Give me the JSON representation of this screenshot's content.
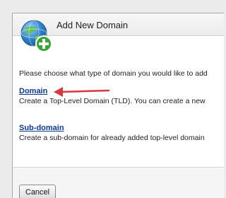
{
  "dialog": {
    "title": "Add New Domain",
    "icon": "globe-add-icon"
  },
  "content": {
    "intro": "Please choose what type of domain you would like to add",
    "options": [
      {
        "label": "Domain",
        "description": "Create a Top-Level Domain (TLD). You can create a new"
      },
      {
        "label": "Sub-domain",
        "description": "Create a sub-domain for already added top-level domain"
      }
    ]
  },
  "footer": {
    "cancel_label": "Cancel"
  },
  "colors": {
    "link": "#0b3a8a",
    "arrow": "#d9363e",
    "globe": "#2f83c9",
    "plus_badge": "#39a532"
  }
}
